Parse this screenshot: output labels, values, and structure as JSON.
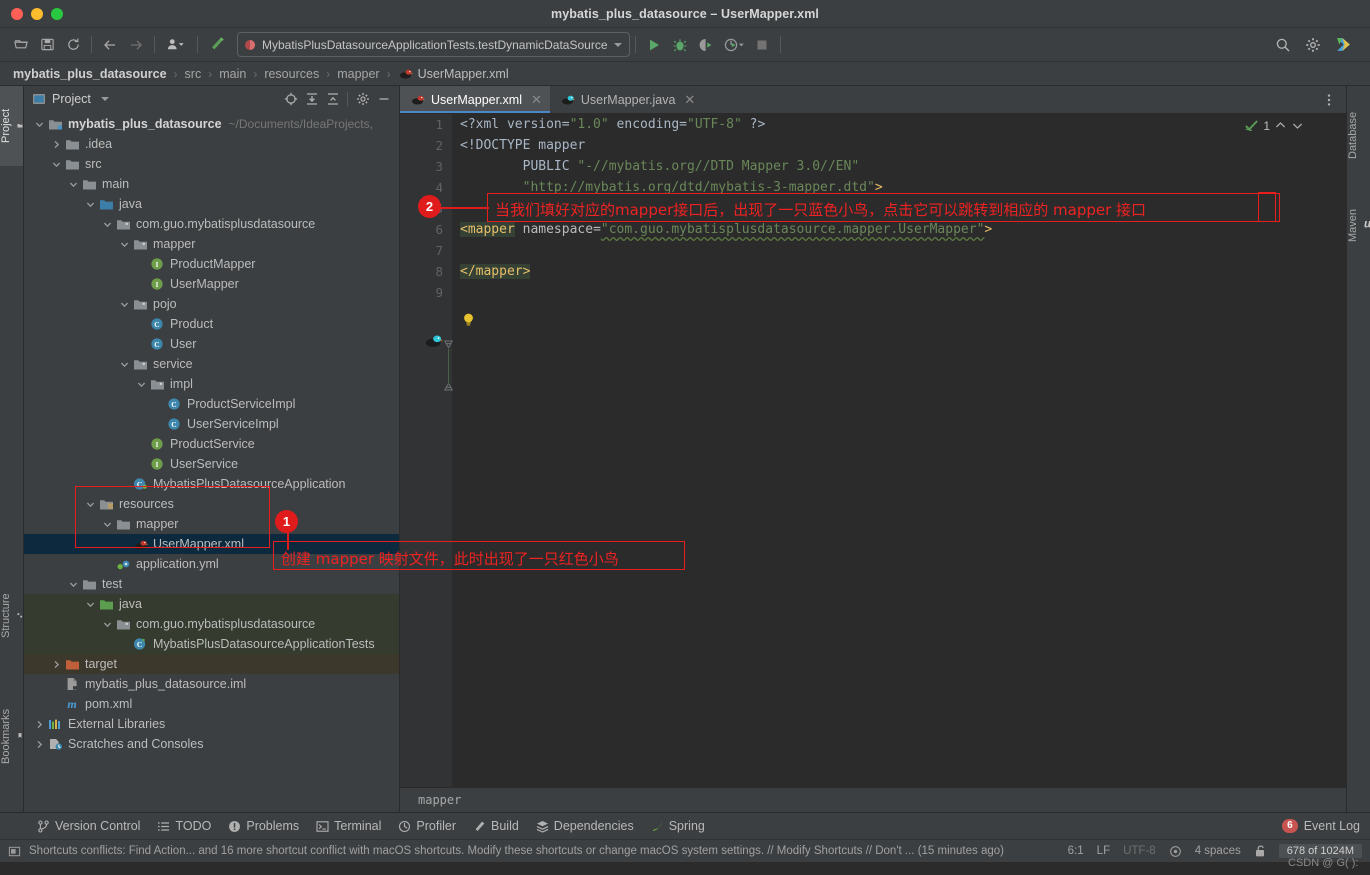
{
  "window": {
    "title": "mybatis_plus_datasource – UserMapper.xml"
  },
  "toolbar": {
    "icons": [
      "open-project-icon",
      "save-all-icon",
      "sync-icon",
      "back-arrow-icon",
      "forward-arrow-icon",
      "user-profile-icon",
      "build-hammer-icon"
    ],
    "run_config": "MybatisPlusDatasourceApplicationTests.testDynamicDataSource",
    "run_label": "Run",
    "debug_label": "Debug",
    "coverage_label": "Run with Coverage",
    "profiler_label": "Profile",
    "stop_label": "Stop",
    "search_label": "Search Everywhere",
    "settings_label": "Settings",
    "ide_label": "IDE Services"
  },
  "breadcrumbs": {
    "items": [
      "mybatis_plus_datasource",
      "src",
      "main",
      "resources",
      "mapper"
    ],
    "file": "UserMapper.xml"
  },
  "left_rail": [
    {
      "label": "Project",
      "icon": "project-folder-icon",
      "active": true
    },
    {
      "label": "Structure",
      "icon": "structure-icon",
      "active": false
    },
    {
      "label": "Bookmarks",
      "icon": "bookmark-icon",
      "active": false
    }
  ],
  "right_rail": [
    {
      "label": "Database",
      "icon": "database-icon"
    },
    {
      "label": "Maven",
      "icon": "maven-m-icon"
    }
  ],
  "project_panel": {
    "title": "Project",
    "actions": [
      "select-opened-file-icon",
      "expand-all-icon",
      "collapse-all-icon",
      "settings-gear-icon",
      "hide-icon"
    ]
  },
  "tree": [
    {
      "indent": 0,
      "arrow": "down",
      "icon": "module-icon",
      "label": "mybatis_plus_datasource",
      "sub": "~/Documents/IdeaProjects,",
      "bold": true
    },
    {
      "indent": 1,
      "arrow": "right",
      "icon": "folder-icon",
      "label": ".idea"
    },
    {
      "indent": 1,
      "arrow": "down",
      "icon": "folder-icon",
      "label": "src"
    },
    {
      "indent": 2,
      "arrow": "down",
      "icon": "folder-icon",
      "label": "main"
    },
    {
      "indent": 3,
      "arrow": "down",
      "icon": "folder-source-icon",
      "label": "java"
    },
    {
      "indent": 4,
      "arrow": "down",
      "icon": "package-icon",
      "label": "com.guo.mybatisplusdatasource"
    },
    {
      "indent": 5,
      "arrow": "down",
      "icon": "package-icon",
      "label": "mapper"
    },
    {
      "indent": 6,
      "arrow": "none",
      "icon": "interface-icon",
      "label": "ProductMapper"
    },
    {
      "indent": 6,
      "arrow": "none",
      "icon": "interface-icon",
      "label": "UserMapper"
    },
    {
      "indent": 5,
      "arrow": "down",
      "icon": "package-icon",
      "label": "pojo"
    },
    {
      "indent": 6,
      "arrow": "none",
      "icon": "class-icon",
      "label": "Product"
    },
    {
      "indent": 6,
      "arrow": "none",
      "icon": "class-icon",
      "label": "User"
    },
    {
      "indent": 5,
      "arrow": "down",
      "icon": "package-icon",
      "label": "service"
    },
    {
      "indent": 6,
      "arrow": "down",
      "icon": "package-icon",
      "label": "impl"
    },
    {
      "indent": 7,
      "arrow": "none",
      "icon": "class-icon",
      "label": "ProductServiceImpl"
    },
    {
      "indent": 7,
      "arrow": "none",
      "icon": "class-icon",
      "label": "UserServiceImpl"
    },
    {
      "indent": 6,
      "arrow": "none",
      "icon": "interface-icon",
      "label": "ProductService"
    },
    {
      "indent": 6,
      "arrow": "none",
      "icon": "interface-icon",
      "label": "UserService"
    },
    {
      "indent": 5,
      "arrow": "none",
      "icon": "spring-class-icon",
      "label": "MybatisPlusDatasourceApplication"
    },
    {
      "indent": 3,
      "arrow": "down",
      "icon": "folder-resource-icon",
      "label": "resources"
    },
    {
      "indent": 4,
      "arrow": "down",
      "icon": "folder-icon",
      "label": "mapper"
    },
    {
      "indent": 5,
      "arrow": "none",
      "icon": "mybatis-red-bird-icon",
      "label": "UserMapper.xml",
      "selected": true
    },
    {
      "indent": 4,
      "arrow": "none",
      "icon": "yml-spring-icon",
      "label": "application.yml"
    },
    {
      "indent": 2,
      "arrow": "down",
      "icon": "folder-icon",
      "label": "test"
    },
    {
      "indent": 3,
      "arrow": "down",
      "icon": "folder-test-icon",
      "label": "java",
      "scope": "test"
    },
    {
      "indent": 4,
      "arrow": "down",
      "icon": "package-icon",
      "label": "com.guo.mybatisplusdatasource",
      "scope": "test"
    },
    {
      "indent": 5,
      "arrow": "none",
      "icon": "test-class-icon",
      "label": "MybatisPlusDatasourceApplicationTests",
      "scope": "test"
    },
    {
      "indent": 1,
      "arrow": "right",
      "icon": "folder-target-icon",
      "label": "target",
      "scope": "target"
    },
    {
      "indent": 1,
      "arrow": "none",
      "icon": "iml-icon",
      "label": "mybatis_plus_datasource.iml"
    },
    {
      "indent": 1,
      "arrow": "none",
      "icon": "maven-m-icon",
      "label": "pom.xml"
    },
    {
      "indent": 0,
      "arrow": "right",
      "icon": "libraries-icon",
      "label": "External Libraries"
    },
    {
      "indent": 0,
      "arrow": "right",
      "icon": "scratches-icon",
      "label": "Scratches and Consoles"
    }
  ],
  "editor": {
    "tabs": [
      {
        "label": "UserMapper.xml",
        "icon": "mybatis-red-bird-icon",
        "active": true
      },
      {
        "label": "UserMapper.java",
        "icon": "mybatis-blue-bird-icon",
        "active": false
      }
    ],
    "more_label": "More options",
    "inspection_count": "1",
    "breadcrumb": "mapper",
    "lines": [
      {
        "n": "1",
        "html": "<span class='t-plain'>&lt;?xml version=</span><span class='t-str'>\"1.0\"</span><span class='t-plain'> encoding=</span><span class='t-str'>\"UTF-8\"</span><span class='t-plain'> ?&gt;</span>"
      },
      {
        "n": "2",
        "html": "<span class='t-plain'>&lt;!DOCTYPE mapper</span>"
      },
      {
        "n": "3",
        "html": "<span class='t-plain'>        PUBLIC </span><span class='t-str'>\"-//mybatis.org//DTD Mapper 3.0//EN\"</span>"
      },
      {
        "n": "4",
        "html": "<span class='t-plain'>        </span><span class='t-str'>\"http://mybatis.org/dtd/mybatis-3-mapper.dtd\"</span><span class='t-tag'>&gt;</span>"
      },
      {
        "n": "5",
        "html": ""
      },
      {
        "n": "6",
        "html": "<span class='hl t-tag'>&lt;mapper</span><span class='t-attr'> namespace=</span><span class='t-val underline-wavy'>\"com.guo.mybatisplusdatasource.mapper.UserMapper\"</span><span class='t-tag'>&gt;</span>"
      },
      {
        "n": "7",
        "html": ""
      },
      {
        "n": "8",
        "html": "<span class='hl t-tag'>&lt;/mapper&gt;</span>"
      },
      {
        "n": "9",
        "html": ""
      }
    ],
    "codeline_texts": [
      "<?xml version=\"1.0\" encoding=\"UTF-8\" ?>",
      "<!DOCTYPE mapper",
      "        PUBLIC \"-//mybatis.org//DTD Mapper 3.0//EN\"",
      "        \"http://mybatis.org/dtd/mybatis-3-mapper.dtd\">",
      "",
      "<mapper namespace=\"com.guo.mybatisplusdatasource.mapper.UserMapper\">",
      "",
      "</mapper>",
      ""
    ]
  },
  "tool_window_bar": {
    "items": [
      {
        "label": "Version Control",
        "icon": "vcs-branch-icon"
      },
      {
        "label": "TODO",
        "icon": "todo-list-icon"
      },
      {
        "label": "Problems",
        "icon": "problems-icon"
      },
      {
        "label": "Terminal",
        "icon": "terminal-icon"
      },
      {
        "label": "Profiler",
        "icon": "profiler-icon"
      },
      {
        "label": "Build",
        "icon": "build-hammer-icon"
      },
      {
        "label": "Dependencies",
        "icon": "dependencies-icon"
      },
      {
        "label": "Spring",
        "icon": "spring-leaf-icon"
      }
    ],
    "event_log": "Event Log",
    "event_log_count": "6"
  },
  "status_bar": {
    "message": "Shortcuts conflicts: Find Action... and 16 more shortcut conflict with macOS shortcuts. Modify these shortcuts or change macOS system settings. // Modify Shortcuts // Don't ... (15 minutes ago)",
    "caret": "6:1",
    "line_sep": "LF",
    "encoding": "UTF-8",
    "indent": "4 spaces",
    "memory": "678 of 1024M",
    "lock_icon": "unlocked-padlock-icon",
    "inspections_icon": "inspections-eye-icon"
  },
  "annotations": [
    {
      "num": "1",
      "text": "创建 mapper 映射文件，此时出现了一只红色小鸟"
    },
    {
      "num": "2",
      "text": "当我们填好对应的mapper接口后，出现了一只蓝色小鸟，点击它可以跳转到相应的 mapper 接口"
    }
  ],
  "watermark": "CSDN @ G( ):",
  "colors": {
    "accent_red": "#e01b1b",
    "tab_underline": "#4a88c7",
    "selection": "#0d293e",
    "panel_bg": "#3c3f41",
    "editor_bg": "#2b2b2b"
  }
}
